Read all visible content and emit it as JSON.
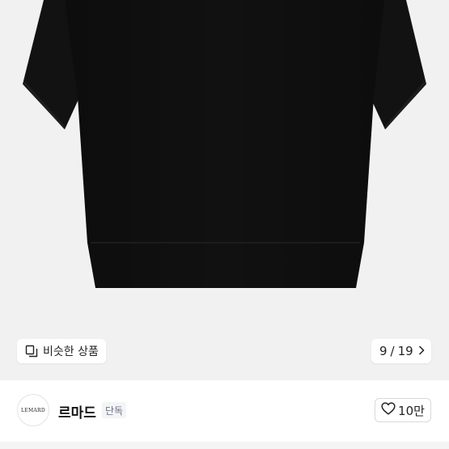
{
  "gallery": {
    "product_image": "black-short-sleeve-knit-top",
    "similar_button": {
      "icon": "similar-items-icon",
      "label": "비슷한 상품"
    },
    "counter": {
      "current": "9",
      "separator": "/",
      "total": "19",
      "icon": "chevron-right-icon"
    }
  },
  "brand": {
    "logo_text": "LEMARD",
    "name": "르마드",
    "badge": "단독",
    "like": {
      "icon": "heart-outline-icon",
      "count": "10만"
    }
  },
  "colors": {
    "gallery_bg": "#f1f1f1",
    "product": "#111111",
    "text": "#222222",
    "badge_bg": "#f3f4f6",
    "badge_text": "#6b7280"
  }
}
